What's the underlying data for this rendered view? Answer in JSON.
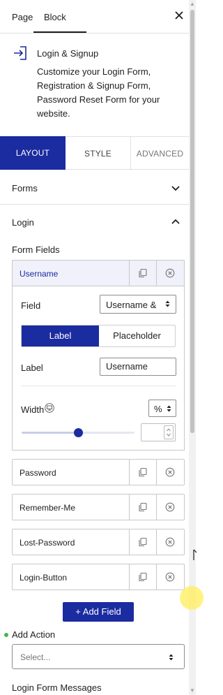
{
  "tabs": {
    "page": "Page",
    "block": "Block"
  },
  "block": {
    "title": "Login & Signup",
    "description": "Customize your Login Form, Registration & Signup Form, Password Reset Form for your website."
  },
  "inspector_tabs": {
    "layout": "LAYOUT",
    "style": "STYLE",
    "advanced": "ADVANCED"
  },
  "panels": {
    "forms": "Forms",
    "login": "Login"
  },
  "form_fields": {
    "heading": "Form Fields",
    "fields": [
      "Username",
      "Password",
      "Remember-Me",
      "Lost-Password",
      "Login-Button"
    ]
  },
  "field_editor": {
    "field_label": "Field",
    "field_value": "Username &",
    "toggle_label": "Label",
    "toggle_placeholder": "Placeholder",
    "label_label": "Label",
    "label_value": "Username",
    "width_label": "Width",
    "unit": "%",
    "width_value": ""
  },
  "add_field_button": "+ Add Field",
  "add_action": {
    "label": "Add Action",
    "placeholder": "Select..."
  },
  "messages_heading": "Login Form Messages",
  "colors": {
    "accent": "#1b2ba0",
    "status_dot": "#46b450"
  }
}
